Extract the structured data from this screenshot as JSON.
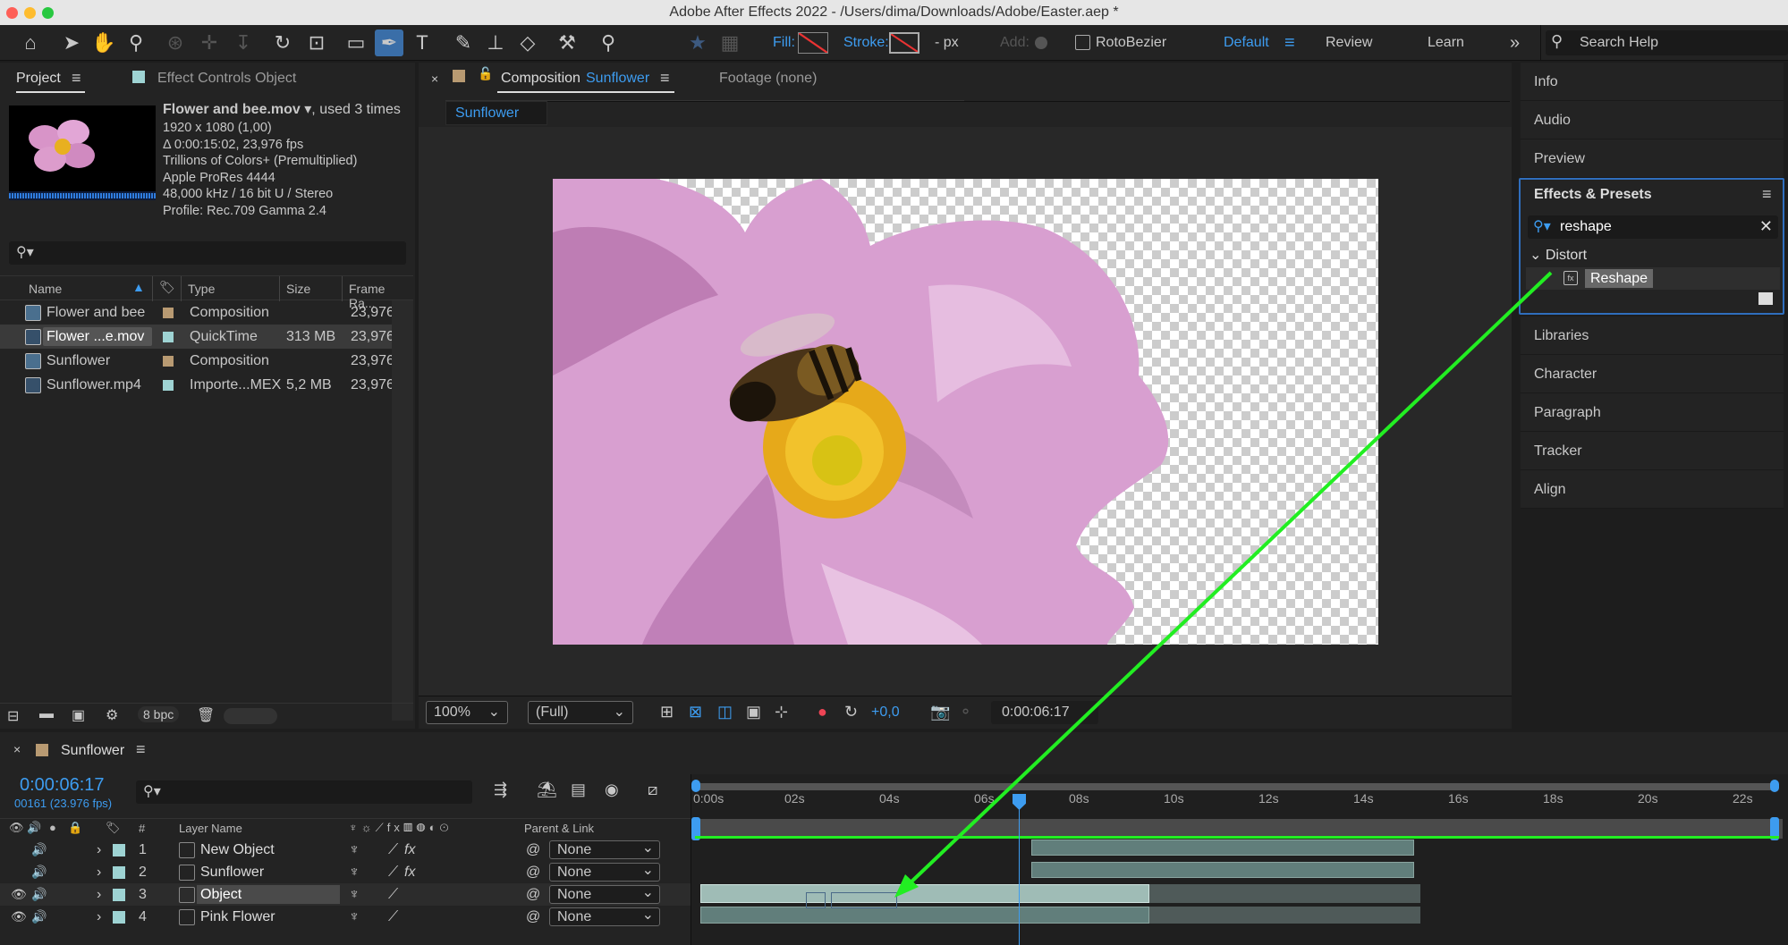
{
  "window": {
    "title": "Adobe After Effects 2022 - /Users/dima/Downloads/Adobe/Easter.aep *"
  },
  "toolbar": {
    "fill_label": "Fill:",
    "stroke_label": "Stroke:",
    "px_label": "- px",
    "add_label": "Add:",
    "rotobezier_label": "RotoBezier",
    "workspace_default": "Default",
    "workspace_review": "Review",
    "workspace_learn": "Learn",
    "search_placeholder": "Search Help"
  },
  "project": {
    "tab_project": "Project",
    "tab_effect_controls": "Effect Controls Object",
    "footage": {
      "name": "Flower and bee.mov",
      "used": ", used 3 times",
      "meta": [
        "1920 x 1080 (1,00)",
        "Δ 0:00:15:02, 23,976 fps",
        "Trillions of Colors+ (Premultiplied)",
        "Apple ProRes 4444",
        "48,000 kHz / 16 bit U / Stereo",
        "Profile: Rec.709 Gamma 2.4"
      ]
    },
    "columns": {
      "name": "Name",
      "type": "Type",
      "size": "Size",
      "frame_rate": "Frame Ra..."
    },
    "items": [
      {
        "name": "Flower and bee",
        "type": "Composition",
        "size": "",
        "fps": "23,976",
        "color": "#b89a72"
      },
      {
        "name": "Flower ...e.mov",
        "type": "QuickTime",
        "size": "313 MB",
        "fps": "23,976",
        "color": "#9ed3d3"
      },
      {
        "name": "Sunflower",
        "type": "Composition",
        "size": "",
        "fps": "23,976",
        "color": "#b89a72"
      },
      {
        "name": "Sunflower.mp4",
        "type": "Importe...MEX",
        "size": "5,2 MB",
        "fps": "23,976",
        "color": "#9ed3d3"
      }
    ],
    "bpc": "8 bpc"
  },
  "composition": {
    "tab_label": "Composition",
    "comp_name": "Sunflower",
    "footage_tab": "Footage (none)",
    "breadcrumb": "Sunflower",
    "zoom": "100%",
    "resolution": "(Full)",
    "exposure": "+0,0",
    "timecode": "0:00:06:17"
  },
  "right_panel": {
    "items_top": [
      "Info",
      "Audio",
      "Preview"
    ],
    "effects_title": "Effects & Presets",
    "search_value": "reshape",
    "category": "Distort",
    "effect": "Reshape",
    "items_bottom": [
      "Libraries",
      "Character",
      "Paragraph",
      "Tracker",
      "Align"
    ]
  },
  "timeline": {
    "tab": "Sunflower",
    "timecode": "0:00:06:17",
    "frames": "00161 (23.976 fps)",
    "col_layer_name": "Layer Name",
    "col_parent": "Parent & Link",
    "col_num": "#",
    "ticks": [
      "0:00s",
      "02s",
      "04s",
      "06s",
      "08s",
      "10s",
      "12s",
      "14s",
      "16s",
      "18s",
      "20s",
      "22s"
    ],
    "layers": [
      {
        "num": "1",
        "name": "New Object",
        "parent": "None",
        "fx": "fx"
      },
      {
        "num": "2",
        "name": "Sunflower",
        "parent": "None",
        "fx": "fx"
      },
      {
        "num": "3",
        "name": "Object",
        "parent": "None",
        "fx": ""
      },
      {
        "num": "4",
        "name": "Pink Flower",
        "parent": "None",
        "fx": ""
      }
    ]
  },
  "colors": {
    "accent": "#3d9cf0",
    "arrow": "#22ee22",
    "panel": "#232323"
  }
}
